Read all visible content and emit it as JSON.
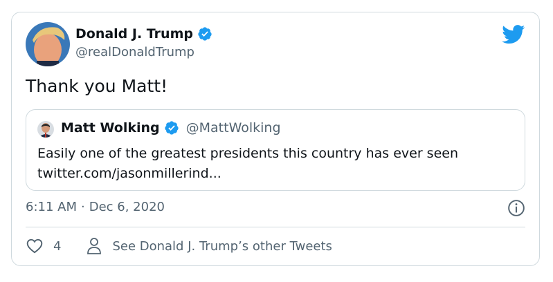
{
  "author": {
    "name": "Donald J. Trump",
    "handle": "@realDonaldTrump"
  },
  "tweet": {
    "text": "Thank you Matt!",
    "time": "6:11 AM",
    "separator": "·",
    "date": "Dec 6, 2020"
  },
  "quoted": {
    "name": "Matt Wolking",
    "handle": "@MattWolking",
    "text_line1": "Easily one of the greatest presidents this country has ever seen",
    "text_line2": "twitter.com/jasonmillerind..."
  },
  "actions": {
    "like_count": "4",
    "profile_link": "See Donald J. Trump’s other Tweets"
  },
  "colors": {
    "twitter_blue": "#1d9bf0",
    "text_secondary": "#536471",
    "border": "#cfd9de"
  },
  "icons": [
    "verified-badge-icon",
    "twitter-bird-icon",
    "info-icon",
    "heart-icon",
    "person-icon"
  ]
}
